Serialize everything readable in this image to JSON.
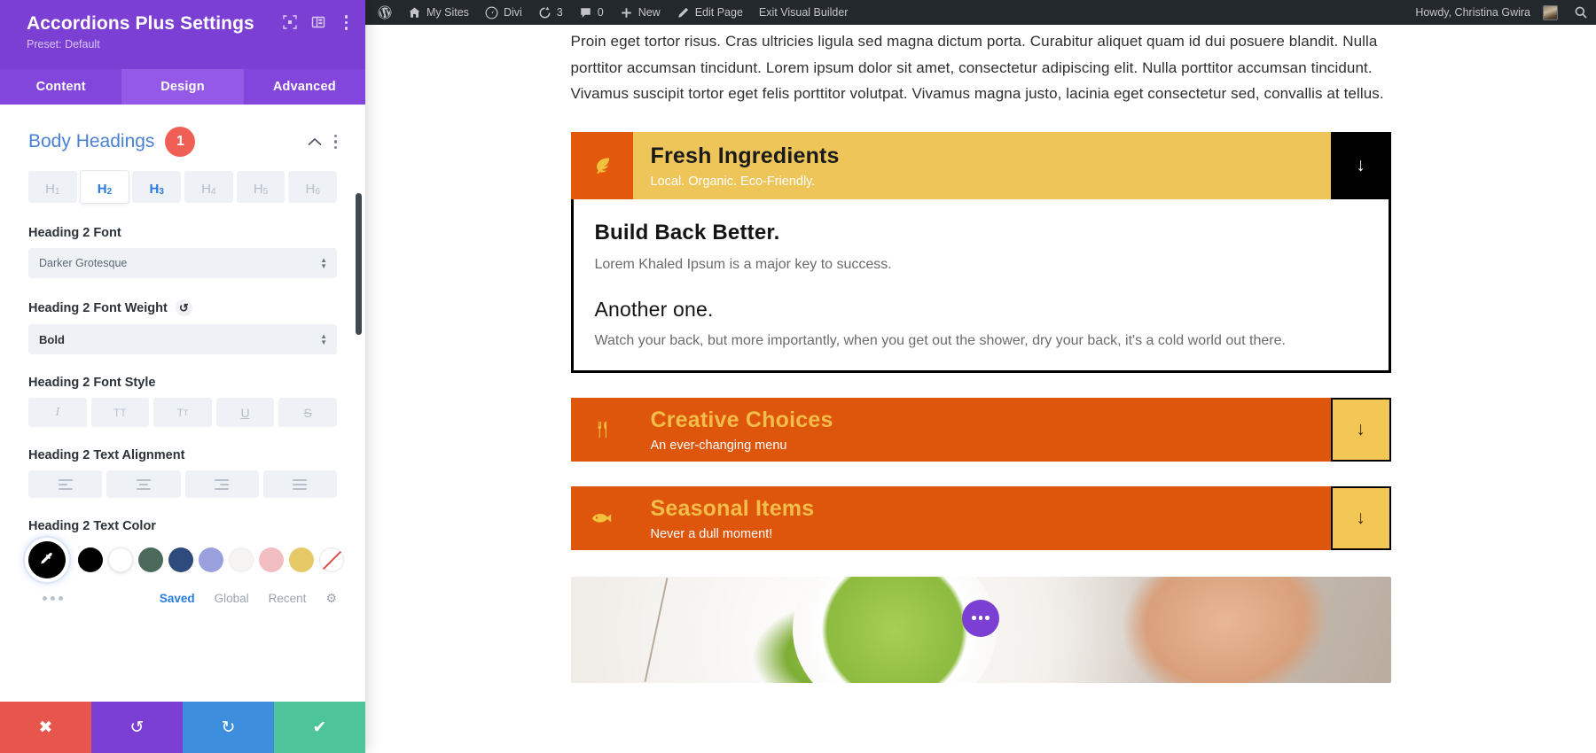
{
  "settings": {
    "title": "Accordions Plus Settings",
    "preset": "Preset: Default",
    "header_icons": [
      "expand-icon",
      "layout-icon",
      "more-vertical-icon"
    ],
    "tabs": [
      {
        "label": "Content",
        "active": false
      },
      {
        "label": "Design",
        "active": true
      },
      {
        "label": "Advanced",
        "active": false
      }
    ],
    "section": {
      "title": "Body Headings",
      "badge": "1",
      "collapse_icon": "chevron-up-icon",
      "more_icon": "more-vertical-icon"
    },
    "heading_tabs": [
      {
        "label": "H",
        "sub": "1",
        "state": "idle"
      },
      {
        "label": "H",
        "sub": "2",
        "state": "selected"
      },
      {
        "label": "H",
        "sub": "3",
        "state": "highlighted"
      },
      {
        "label": "H",
        "sub": "4",
        "state": "idle"
      },
      {
        "label": "H",
        "sub": "5",
        "state": "idle"
      },
      {
        "label": "H",
        "sub": "6",
        "state": "idle"
      }
    ],
    "font_field": {
      "label": "Heading 2 Font",
      "value": "Darker Grotesque"
    },
    "weight_field": {
      "label": "Heading 2 Font Weight",
      "value": "Bold",
      "reset_icon": "reset-icon"
    },
    "style_field": {
      "label": "Heading 2 Font Style",
      "options": [
        "I",
        "TT",
        "Tт",
        "U",
        "S"
      ]
    },
    "align_field": {
      "label": "Heading 2 Text Alignment",
      "options": [
        "align-left-icon",
        "align-center-icon",
        "align-right-icon",
        "align-justify-icon"
      ]
    },
    "color_field": {
      "label": "Heading 2 Text Color",
      "active_swatch": "eyedropper-icon",
      "active_color": "#000000",
      "swatches": [
        "#000000",
        "#ffffff",
        "#4c6a5c",
        "#2f4a7c",
        "#9aa0dd",
        "#f7f4f2",
        "#f2bec2",
        "#e6c967",
        "none"
      ],
      "links": [
        {
          "label": "Saved",
          "active": true
        },
        {
          "label": "Global",
          "active": false
        },
        {
          "label": "Recent",
          "active": false
        }
      ],
      "more_icon": "ellipsis-icon",
      "gear_icon": "gear-icon"
    },
    "footer_buttons": [
      {
        "name": "discard",
        "icon": "✖",
        "color": "#e7564c"
      },
      {
        "name": "undo",
        "icon": "↺",
        "color": "#7b3fd3"
      },
      {
        "name": "redo",
        "icon": "↻",
        "color": "#3d8fdd"
      },
      {
        "name": "save",
        "icon": "✔",
        "color": "#4ec49a"
      }
    ]
  },
  "adminbar": {
    "items": [
      {
        "icon": "wordpress-logo-icon",
        "label": ""
      },
      {
        "icon": "home-icon",
        "label": "My Sites"
      },
      {
        "icon": "dashboard-icon",
        "label": "Divi"
      },
      {
        "icon": "update-icon",
        "label": "3"
      },
      {
        "icon": "comment-icon",
        "label": "0"
      },
      {
        "icon": "plus-icon",
        "label": "New"
      },
      {
        "icon": "pencil-icon",
        "label": "Edit Page"
      },
      {
        "icon": "",
        "label": "Exit Visual Builder"
      }
    ],
    "howdy": "Howdy, Christina Gwira",
    "avatar": "user-avatar",
    "search_icon": "search-icon"
  },
  "page": {
    "paragraph": "Proin eget tortor risus. Cras ultricies ligula sed magna dictum porta. Curabitur aliquet quam id dui posuere blandit. Nulla porttitor accumsan tincidunt. Lorem ipsum dolor sit amet, consectetur adipiscing elit. Nulla porttitor accumsan tincidunt. Vivamus suscipit tortor eget felis porttitor volutpat. Vivamus magna justo, lacinia eget consectetur sed, convallis at tellus.",
    "accordions": [
      {
        "icon": "leaf-icon",
        "title": "Fresh Ingredients",
        "subtitle": "Local. Organic. Eco-Friendly.",
        "toggle_icon": "↓",
        "open": true,
        "content": {
          "h2_first": "Build Back Better.",
          "p_first": "Lorem Khaled Ipsum is a major key to success.",
          "h2_second": "Another one.",
          "p_second": "Watch your back, but more importantly, when you get out the shower, dry your back, it's a cold world out there."
        }
      },
      {
        "icon": "cutlery-icon",
        "title": "Creative Choices",
        "subtitle": "An ever-changing menu",
        "toggle_icon": "↓",
        "open": false
      },
      {
        "icon": "fish-icon",
        "title": "Seasonal Items",
        "subtitle": "Never a dull moment!",
        "toggle_icon": "↓",
        "open": false
      }
    ],
    "fab_icon": "more-horizontal-icon"
  }
}
